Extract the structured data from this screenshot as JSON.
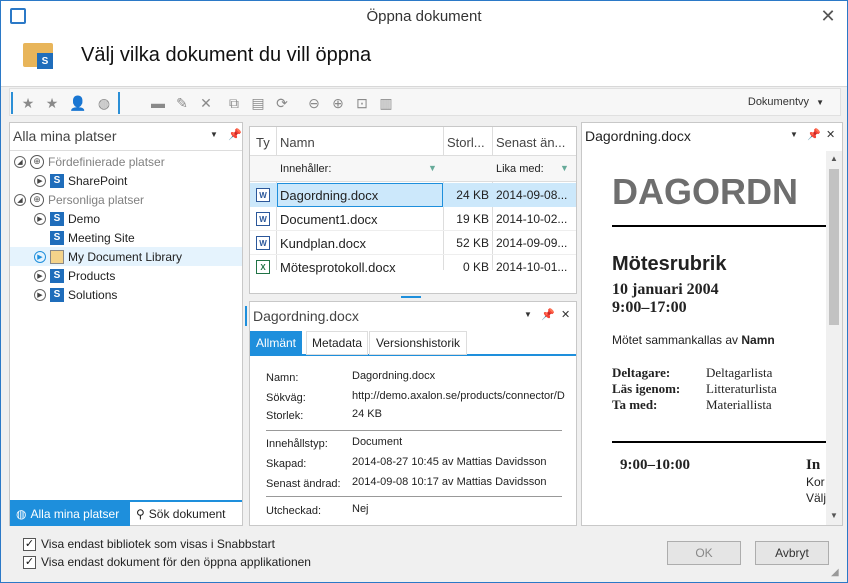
{
  "window": {
    "title": "Öppna dokument"
  },
  "header": {
    "title": "Välj vilka dokument du vill öppna"
  },
  "toolbar": {
    "view_label": "Dokumentvy"
  },
  "left_panel": {
    "title": "Alla mina platser",
    "groups": [
      {
        "label": "Fördefinierade platser",
        "items": [
          "SharePoint"
        ]
      },
      {
        "label": "Personliga platser",
        "items": [
          "Demo",
          "Meeting Site",
          "My Document Library",
          "Products",
          "Solutions"
        ]
      }
    ],
    "tabs": [
      "Alla mina platser",
      "Sök dokument"
    ]
  },
  "grid": {
    "columns": [
      "Ty",
      "Namn",
      "Storl...",
      "Senast än..."
    ],
    "filter": {
      "name": "Innehåller:",
      "date": "Lika med:"
    },
    "rows": [
      {
        "name": "Dagordning.docx",
        "size": "24 KB",
        "date": "2014-09-08...",
        "type": "word"
      },
      {
        "name": "Document1.docx",
        "size": "19 KB",
        "date": "2014-10-02...",
        "type": "word"
      },
      {
        "name": "Kundplan.docx",
        "size": "52 KB",
        "date": "2014-09-09...",
        "type": "word"
      },
      {
        "name": "Mötesprotokoll.docx",
        "size": "0 KB",
        "date": "2014-10-01...",
        "type": "excel"
      }
    ]
  },
  "details": {
    "title": "Dagordning.docx",
    "tabs": [
      "Allmänt",
      "Metadata",
      "Versionshistorik"
    ],
    "props": [
      {
        "label": "Namn:",
        "value": "Dagordning.docx"
      },
      {
        "label": "Sökväg:",
        "value": "http://demo.axalon.se/products/connector/D"
      },
      {
        "label": "Storlek:",
        "value": "24 KB"
      },
      {
        "label": "Innehållstyp:",
        "value": "Document"
      },
      {
        "label": "Skapad:",
        "value": "2014-08-27 10:45 av Mattias Davidsson"
      },
      {
        "label": "Senast ändrad:",
        "value": "2014-09-08 10:17 av Mattias Davidsson"
      },
      {
        "label": "Utcheckad:",
        "value": "Nej"
      }
    ]
  },
  "preview": {
    "title": "Dagordning.docx",
    "doc_heading": "DAGORDN",
    "meeting_title": "Mötesrubrik",
    "date": "10 januari 2004",
    "time": "9:00–17:00",
    "intro_text": "Mötet sammankallas av ",
    "intro_bold": "Namn",
    "rows": [
      {
        "label": "Deltagare:",
        "value": "Deltagarlista"
      },
      {
        "label": "Läs igenom:",
        "value": "Litteraturlista"
      },
      {
        "label": "Ta med:",
        "value": "Materiallista"
      }
    ],
    "slot_time": "9:00–10:00",
    "slot_title": "In",
    "slot_l1": "Kor",
    "slot_l2": "Välj"
  },
  "footer": {
    "check1": "Visa endast bibliotek som visas i Snabbstart",
    "check2": "Visa endast dokument för den öppna applikationen",
    "ok": "OK",
    "cancel": "Avbryt"
  },
  "colors": {
    "accent": "#1e8fdc",
    "selection": "#cce8fb"
  }
}
